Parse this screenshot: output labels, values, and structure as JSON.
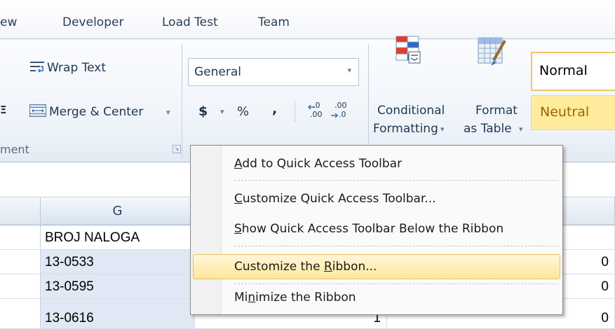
{
  "ribbon_tabs": [
    "ew",
    "Developer",
    "Load Test",
    "Team"
  ],
  "alignment_group": {
    "wrap_text": "Wrap Text",
    "merge_center": "Merge & Center",
    "merge_arrow": "▾",
    "group_label": "ment",
    "partial_glyph": "Ξ"
  },
  "number_group": {
    "format_value": "General",
    "format_arrow": "▾",
    "currency": "$",
    "currency_arrow": "▾",
    "percent": "%",
    "comma": ",",
    "inc_decimal": ".00",
    "dec_decimal": ".00"
  },
  "styles_group": {
    "conditional_line1": "Conditional",
    "conditional_line2": "Formatting",
    "format_table_line1": "Format",
    "format_table_line2": "as Table",
    "dropdown_arrow": "▾",
    "style_normal": "Normal",
    "style_neutral": "Neutral"
  },
  "sheet": {
    "column_g": "G",
    "rows": [
      {
        "g": "BROJ NALOGA",
        "h": "",
        "i": ""
      },
      {
        "g": "13-0533",
        "h": "",
        "i": "0"
      },
      {
        "g": "13-0595",
        "h": "",
        "i": "0"
      },
      {
        "g": "13-0616",
        "h": "1",
        "i": "0"
      }
    ]
  },
  "context_menu": {
    "items": [
      {
        "pre": "",
        "key": "A",
        "post": "dd to Quick Access Toolbar"
      },
      {
        "pre": "",
        "key": "C",
        "post": "ustomize Quick Access Toolbar..."
      },
      {
        "pre": "",
        "key": "S",
        "post": "how Quick Access Toolbar Below the Ribbon"
      },
      {
        "pre": "Customize the ",
        "key": "R",
        "post": "ibbon..."
      },
      {
        "pre": "Mi",
        "key": "n",
        "post": "imize the Ribbon"
      }
    ]
  },
  "colors": {
    "menu_highlight": "#ffe79c",
    "neutral_style": "#ffeb9c",
    "selected_cell": "#dfe8f4"
  }
}
